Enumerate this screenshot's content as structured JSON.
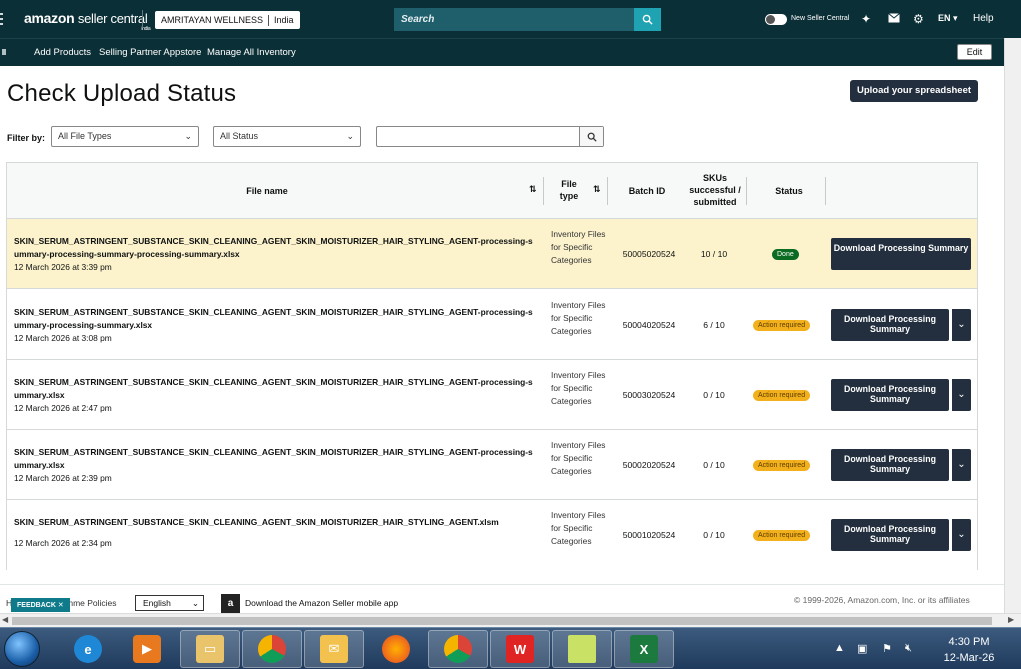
{
  "topnav": {
    "logo_main": "amazon",
    "logo_sub": "seller central",
    "logo_region": "india",
    "account_name": "AMRITAYAN WELLNESS",
    "account_region": "India",
    "search_placeholder": "Search",
    "new_seller_central": "New Seller Central",
    "language": "EN",
    "help": "Help"
  },
  "subnav": {
    "items": [
      "Add Products",
      "Selling Partner Appstore",
      "Manage All Inventory"
    ],
    "edit_label": "Edit"
  },
  "page": {
    "title": "Check Upload Status",
    "upload_button": "Upload your spreadsheet",
    "filter_label": "Filter by:",
    "file_type_filter": "All File Types",
    "status_filter": "All Status",
    "filter_search_value": ""
  },
  "table": {
    "headers": {
      "file_name": "File name",
      "file_type": "File type",
      "batch_id": "Batch ID",
      "skus": "SKUs successful / submitted",
      "status": "Status"
    },
    "rows": [
      {
        "file_name": "SKIN_SERUM_ASTRINGENT_SUBSTANCE_SKIN_CLEANING_AGENT_SKIN_MOISTURIZER_HAIR_STYLING_AGENT-processing-summary-processing-summary-processing-summary.xlsx",
        "date": "12 March 2026 at 3:39 pm",
        "file_type": "Inventory Files for Specific Categories",
        "batch_id": "50005020524",
        "skus": "10 / 10",
        "status": "Done",
        "action": "Download Processing Summary"
      },
      {
        "file_name": "SKIN_SERUM_ASTRINGENT_SUBSTANCE_SKIN_CLEANING_AGENT_SKIN_MOISTURIZER_HAIR_STYLING_AGENT-processing-summary-processing-summary.xlsx",
        "date": "12 March 2026 at 3:08 pm",
        "file_type": "Inventory Files for Specific Categories",
        "batch_id": "50004020524",
        "skus": "6 / 10",
        "status": "Action required",
        "action": "Download Processing Summary"
      },
      {
        "file_name": "SKIN_SERUM_ASTRINGENT_SUBSTANCE_SKIN_CLEANING_AGENT_SKIN_MOISTURIZER_HAIR_STYLING_AGENT-processing-summary.xlsx",
        "date": "12 March 2026 at 2:47 pm",
        "file_type": "Inventory Files for Specific Categories",
        "batch_id": "50003020524",
        "skus": "0 / 10",
        "status": "Action required",
        "action": "Download Processing Summary"
      },
      {
        "file_name": "SKIN_SERUM_ASTRINGENT_SUBSTANCE_SKIN_CLEANING_AGENT_SKIN_MOISTURIZER_HAIR_STYLING_AGENT-processing-summary.xlsx",
        "date": "12 March 2026 at 2:39 pm",
        "file_type": "Inventory Files for Specific Categories",
        "batch_id": "50002020524",
        "skus": "0 / 10",
        "status": "Action required",
        "action": "Download Processing Summary"
      },
      {
        "file_name": "SKIN_SERUM_ASTRINGENT_SUBSTANCE_SKIN_CLEANING_AGENT_SKIN_MOISTURIZER_HAIR_STYLING_AGENT.xlsm",
        "date": "12 March 2026 at 2:34 pm",
        "file_type": "Inventory Files for Specific Categories",
        "batch_id": "50001020524",
        "skus": "0 / 10",
        "status": "Action required",
        "action": "Download Processing Summary"
      }
    ]
  },
  "footer": {
    "feedback": "FEEDBACK",
    "policies_prefix": "H",
    "policies_suffix": "mme Policies",
    "language_select": "English",
    "app_link": "Download the Amazon Seller mobile app",
    "copyright": "© 1999-2026, Amazon.com, Inc. or its affiliates"
  },
  "taskbar": {
    "time": "4:30 PM",
    "date": "12-Mar-26",
    "apps": [
      "internet-explorer",
      "media-player",
      "file-explorer",
      "chrome-profile",
      "outlook",
      "firefox",
      "chrome",
      "wps-office",
      "sticky-notes",
      "excel"
    ]
  },
  "colors": {
    "nav_bg": "#0b2f36",
    "search_btn": "#1fa3b3",
    "button_dark": "#232f3e",
    "done_badge": "#0b6b22",
    "action_badge": "#f3b01d",
    "highlight_row": "#fcf3cd"
  }
}
